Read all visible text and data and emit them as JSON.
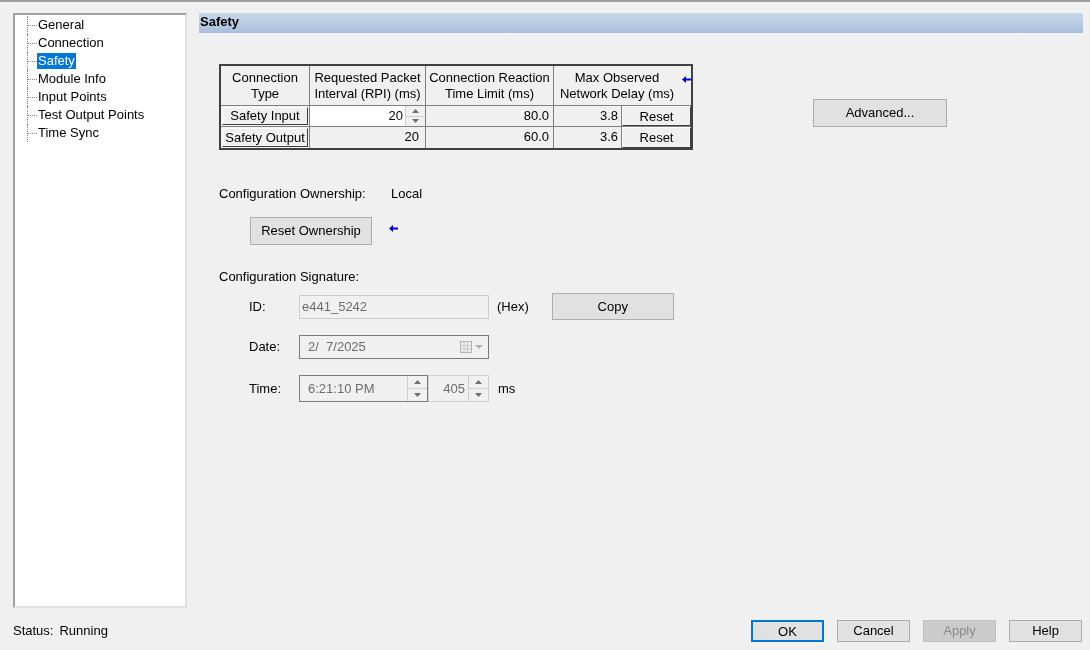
{
  "tree": {
    "items": [
      {
        "label": "General",
        "selected": false
      },
      {
        "label": "Connection",
        "selected": false
      },
      {
        "label": "Safety",
        "selected": true
      },
      {
        "label": "Module Info",
        "selected": false
      },
      {
        "label": "Input Points",
        "selected": false
      },
      {
        "label": "Test Output Points",
        "selected": false
      },
      {
        "label": "Time Sync",
        "selected": false
      }
    ]
  },
  "section_title": "Safety",
  "connections": {
    "columns": [
      "Connection Type",
      "Requested Packet Interval (RPI) (ms)",
      "Connection Reaction Time Limit (ms)",
      "Max Observed Network Delay (ms)"
    ],
    "rows": [
      {
        "type": "Safety Input",
        "rpi": "20",
        "kind": "spinner",
        "reaction_limit": "80.0",
        "max_delay": "3.8",
        "reset_button": "Reset"
      },
      {
        "type": "Safety Output",
        "rpi": "20",
        "kind": "plain",
        "reaction_limit": "60.0",
        "max_delay": "3.6",
        "reset_button": "Reset"
      }
    ]
  },
  "advanced_button": "Advanced...",
  "ownership": {
    "label": "Configuration Ownership:",
    "value": "Local",
    "reset_button": "Reset Ownership"
  },
  "signature": {
    "label": "Configuration Signature:",
    "disabled": true,
    "id": {
      "label": "ID:",
      "value": "e441_5242",
      "unit": "(Hex)"
    },
    "copy_button": "Copy",
    "date": {
      "label": "Date:",
      "value": "2/  7/2025"
    },
    "time": {
      "label": "Time:",
      "value": "6:21:10 PM",
      "ms_value": "405",
      "unit": "ms"
    }
  },
  "status": {
    "label": "Status:",
    "value": "Running"
  },
  "buttons": [
    {
      "label": "OK",
      "disabled": false,
      "focused": true
    },
    {
      "label": "Cancel",
      "disabled": false,
      "focused": false
    },
    {
      "label": "Apply",
      "disabled": true,
      "focused": false
    },
    {
      "label": "Help",
      "disabled": false,
      "focused": false
    }
  ]
}
